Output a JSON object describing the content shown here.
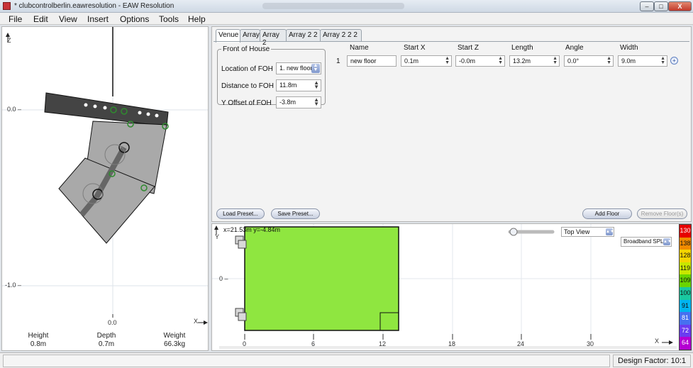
{
  "window": {
    "title": "* clubcontrolberlin.eawresolution - EAW Resolution",
    "minimize_glyph": "‒",
    "maximize_glyph": "□",
    "close_glyph": "X"
  },
  "menu": [
    "File",
    "Edit",
    "View",
    "Insert",
    "Options",
    "Tools",
    "Help"
  ],
  "side_view": {
    "axis_z": "Z",
    "axis_x": "X",
    "tick_00": "0.0 –",
    "tick_m10": "-1.0 –",
    "tick_x0": "0.0",
    "captions": [
      {
        "label": "Height",
        "value": "0.8m"
      },
      {
        "label": "Depth",
        "value": "0.7m"
      },
      {
        "label": "Weight",
        "value": "66.3kg"
      }
    ]
  },
  "tabs": [
    "Venue",
    "Array",
    "Array 2",
    "Array 2 2",
    "Array 2 2 2"
  ],
  "foh": {
    "legend": "Front of House",
    "location_label": "Location of FOH",
    "location_value": "1. new floor",
    "distance_label": "Distance to FOH",
    "distance_value": "11.8m",
    "yoffset_label": "Y Offset of FOH",
    "yoffset_value": "-3.8m"
  },
  "floors": {
    "columns": [
      "Name",
      "Start X",
      "Start Z",
      "Length",
      "Angle",
      "Width"
    ],
    "rows": [
      {
        "index": "1",
        "name": "new floor",
        "start_x": "0.1m",
        "start_z": "-0.0m",
        "length": "13.2m",
        "angle": "0.0°",
        "width": "9.0m"
      }
    ]
  },
  "buttons": {
    "load_preset": "Load Preset...",
    "save_preset": "Save Preset...",
    "add_floor": "Add Floor",
    "remove_floor": "Remove Floor(s)"
  },
  "plan_view": {
    "coord_readout": "x=21.53m y=-4.84m",
    "axis_y": "Y",
    "axis_x": "X",
    "tick_y0": "0 –",
    "x_ticks": [
      "0",
      "6",
      "12",
      "18",
      "24",
      "30"
    ],
    "view_select": "Top View",
    "metric_select": "Broadband SPL C",
    "floor_color": "#8fe640"
  },
  "color_scale": {
    "labels": [
      "130",
      "138",
      "128",
      "119",
      "109",
      "100",
      "91",
      "81",
      "72",
      "64"
    ],
    "colors": [
      "#e60000",
      "#f08a00",
      "#f4d400",
      "#c8e600",
      "#6ad400",
      "#19c8a0",
      "#00b4f0",
      "#4670f0",
      "#6a3cf0",
      "#b400d2"
    ]
  },
  "status": {
    "design_factor": "Design Factor: 10:1"
  }
}
